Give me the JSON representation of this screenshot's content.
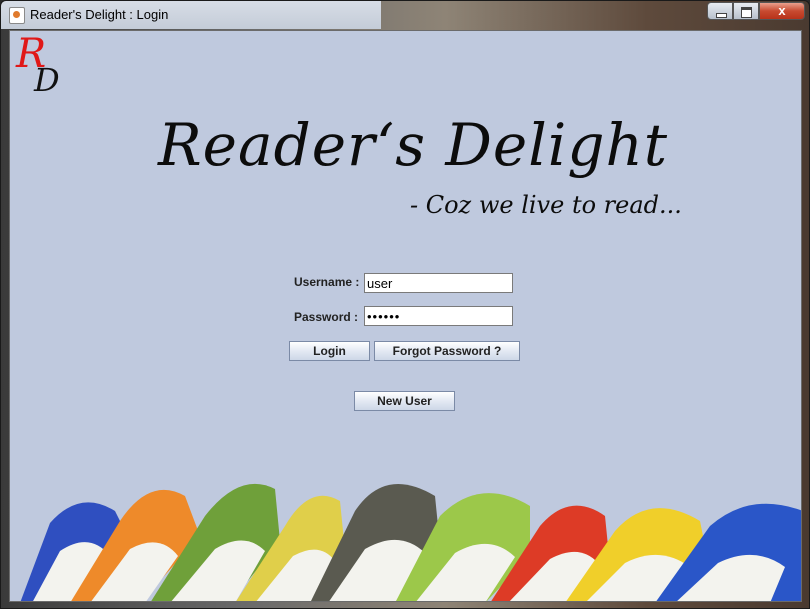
{
  "window": {
    "title": "Reader's Delight : Login",
    "close_glyph": "x"
  },
  "logo": {
    "letter_top": "R",
    "letter_bottom": "D"
  },
  "brand": {
    "title": "Reader‘s Delight",
    "tagline": "- Coz we live to read..."
  },
  "form": {
    "username_label": "Username :",
    "username_value": "user",
    "password_label": "Password :",
    "password_value": "••••••"
  },
  "buttons": {
    "login": "Login",
    "forgot": "Forgot Password ?",
    "new_user": "New User"
  },
  "colors": {
    "content_bg": "#bfc9de",
    "logo_red": "#e01818"
  },
  "books": [
    {
      "cover": "#2f4fc0"
    },
    {
      "cover": "#ee8a2a"
    },
    {
      "cover": "#6fa03a"
    },
    {
      "cover": "#e0cf4a"
    },
    {
      "cover": "#5a5a50"
    },
    {
      "cover": "#9cc84a"
    },
    {
      "cover": "#dd3b26"
    },
    {
      "cover": "#f0cf2a"
    },
    {
      "cover": "#2a56c8"
    }
  ]
}
